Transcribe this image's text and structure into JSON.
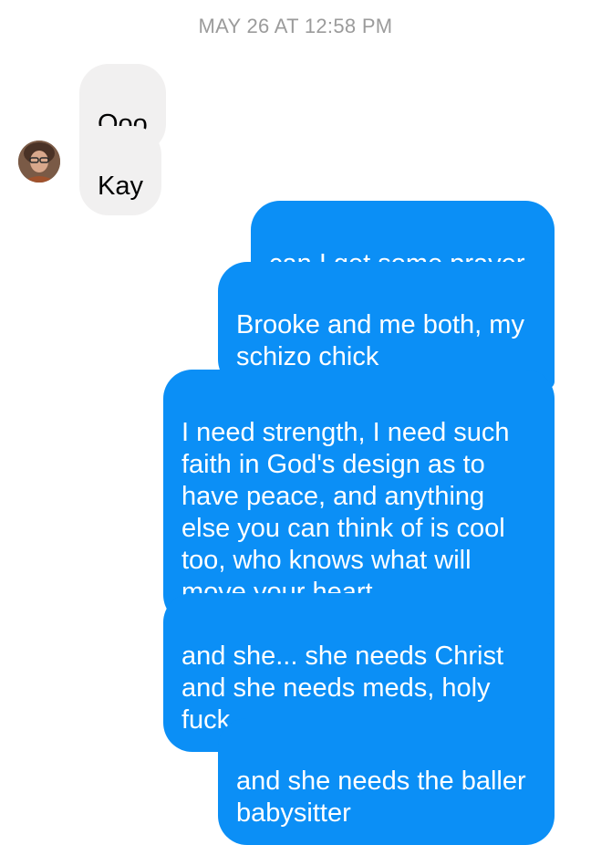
{
  "thread": {
    "timestamp": "MAY 26 AT 12:58 PM"
  },
  "contact": {
    "avatar_icon": "contact-avatar-photo"
  },
  "colors": {
    "incoming_bubble": "#f1f0f0",
    "outgoing_bubble": "#0b8ff6",
    "timestamp_text": "#9b9b9b"
  },
  "messages": [
    {
      "direction": "incoming",
      "text": "Ooo"
    },
    {
      "direction": "incoming",
      "text": "Kay"
    },
    {
      "direction": "outgoing",
      "text": "can I get some prayer"
    },
    {
      "direction": "outgoing",
      "text": "Brooke and me both, my\nschizo chick"
    },
    {
      "direction": "outgoing",
      "text": "I need strength, I need such\nfaith in God's design as to\nhave peace, and anything\nelse you can think of is cool\ntoo, who knows what will\nmove your heart"
    },
    {
      "direction": "outgoing",
      "text": "and she... she needs Christ\nand she needs meds, holy\nfuck"
    },
    {
      "direction": "outgoing",
      "text": "and she needs the baller\nbabysitter"
    }
  ]
}
